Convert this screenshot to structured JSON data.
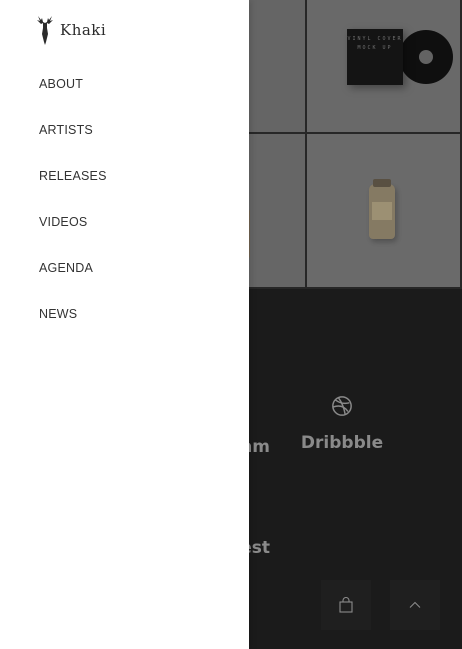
{
  "brand": {
    "name": "Khaki",
    "logo_icon": "deer-head-icon"
  },
  "menu": {
    "items": [
      {
        "label": "ABOUT"
      },
      {
        "label": "ARTISTS"
      },
      {
        "label": "RELEASES"
      },
      {
        "label": "VIDEOS"
      },
      {
        "label": "AGENDA"
      },
      {
        "label": "NEWS"
      }
    ]
  },
  "gallery": {
    "sleeve_text": "VINYL COVER MOCK UP"
  },
  "social": {
    "dribbble": {
      "label": "Dribbble",
      "icon": "dribbble-icon"
    },
    "instagram": {
      "label_fragment": "am"
    },
    "pinterest": {
      "label_fragment": "est"
    }
  },
  "buttons": {
    "cart": {
      "icon": "shopping-bag-icon"
    },
    "back_to_top": {
      "icon": "chevron-up-icon"
    }
  },
  "colors": {
    "menu_bg": "#ffffff",
    "menu_text": "#333333",
    "page_dark": "#262626",
    "button_bg": "#1f1f1f"
  }
}
